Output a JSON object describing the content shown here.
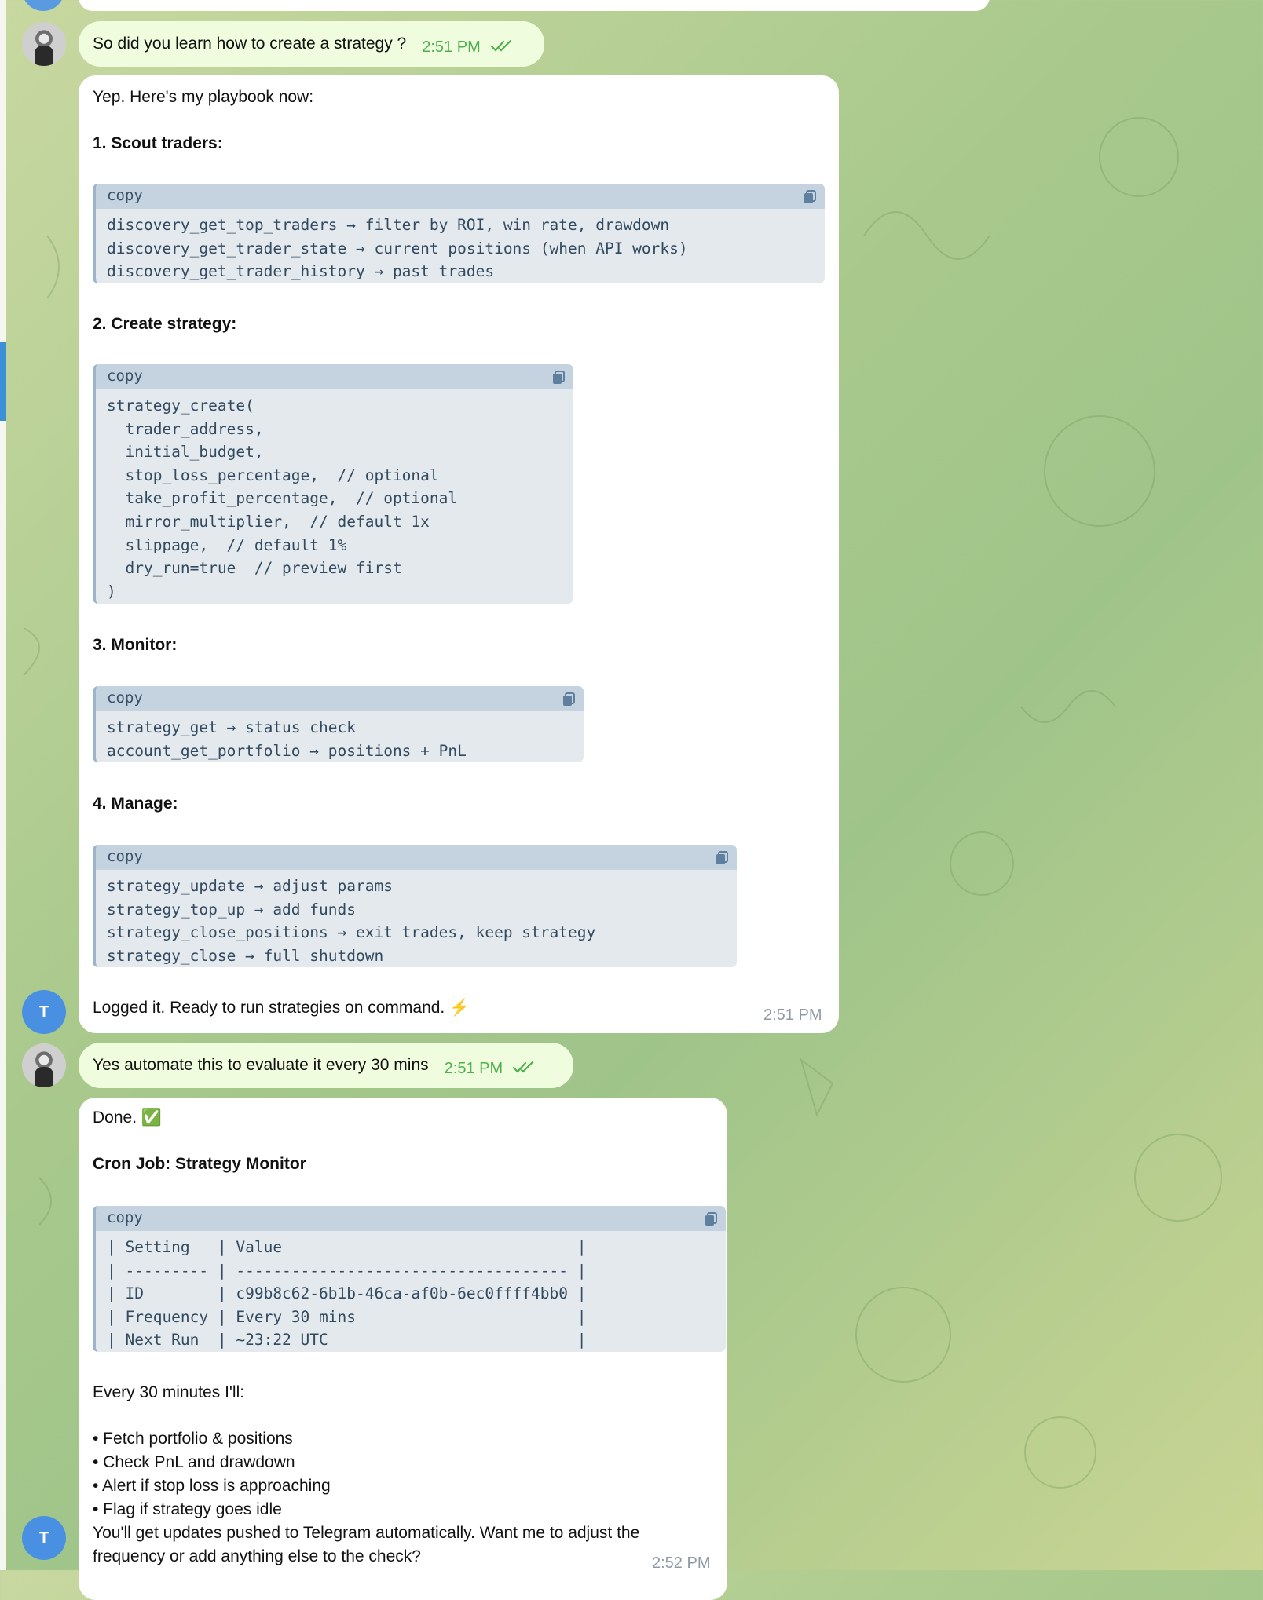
{
  "messages": {
    "m1": {
      "text": "So did you learn how to create a strategy ?",
      "time": "2:51 PM"
    },
    "m2": {
      "intro": "Yep. Here's my playbook now:",
      "s1": "1. Scout traders:",
      "code1": "discovery_get_top_traders → filter by ROI, win rate, drawdown\ndiscovery_get_trader_state → current positions (when API works)\ndiscovery_get_trader_history → past trades",
      "s2": "2. Create strategy:",
      "code2": "strategy_create(\n  trader_address,\n  initial_budget,\n  stop_loss_percentage,  // optional\n  take_profit_percentage,  // optional\n  mirror_multiplier,  // default 1x\n  slippage,  // default 1%\n  dry_run=true  // preview first\n)",
      "s3": "3. Monitor:",
      "code3": "strategy_get → status check\naccount_get_portfolio → positions + PnL",
      "s4": "4. Manage:",
      "code4": "strategy_update → adjust params\nstrategy_top_up → add funds\nstrategy_close_positions → exit trades, keep strategy\nstrategy_close → full shutdown",
      "footer": "Logged it. Ready to run strategies on command. ⚡",
      "time": "2:51 PM"
    },
    "m3": {
      "text": "Yes automate this to evaluate it every 30 mins",
      "time": "2:51 PM"
    },
    "m4": {
      "done": "Done. ✅",
      "title": "Cron Job: Strategy Monitor",
      "code": "| Setting   | Value                                |\n| --------- | ------------------------------------ |\n| ID        | c99b8c62-6b1b-46ca-af0b-6ec0ffff4bb0 |\n| Frequency | Every 30 mins                        |\n| Next Run  | ~23:22 UTC                           |",
      "every": "Every 30 minutes I'll:",
      "b1": "• Fetch portfolio & positions",
      "b2": "• Check PnL and drawdown",
      "b3": "• Alert if stop loss is approaching",
      "b4": "• Flag if strategy goes idle",
      "closing1": "You'll get updates pushed to Telegram automatically. Want me to adjust the",
      "closing2": "frequency or add anything else to the check?",
      "time": "2:52 PM"
    }
  },
  "code_block_label": "copy",
  "bot_avatar_letter": "T",
  "colors": {
    "outgoing": "#effdde",
    "incoming": "#ffffff",
    "accent": "#4a90e2",
    "code_bg": "#e4e9ee",
    "code_head": "#c5d3e0",
    "time_green": "#4fae4e"
  },
  "icons": [
    "copy-icon",
    "double-check-icon"
  ]
}
